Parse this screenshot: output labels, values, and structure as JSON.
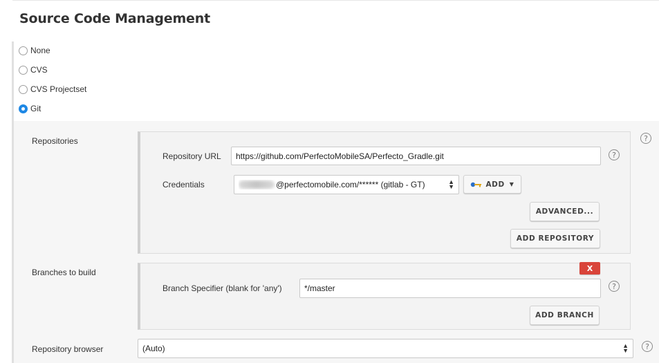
{
  "section": {
    "title": "Source Code Management"
  },
  "scm_options": [
    {
      "label": "None",
      "selected": false
    },
    {
      "label": "CVS",
      "selected": false
    },
    {
      "label": "CVS Projectset",
      "selected": false
    },
    {
      "label": "Git",
      "selected": true
    }
  ],
  "repositories": {
    "label": "Repositories",
    "url_label": "Repository URL",
    "url_value": "https://github.com/PerfectoMobileSA/Perfecto_Gradle.git",
    "credentials_label": "Credentials",
    "credentials_value": "@perfectomobile.com/****** (gitlab - GT)",
    "add_label": "ADD",
    "advanced_label": "ADVANCED...",
    "add_repository_label": "ADD REPOSITORY"
  },
  "branches": {
    "label": "Branches to build",
    "delete_label": "X",
    "specifier_label": "Branch Specifier (blank for 'any')",
    "specifier_value": "*/master",
    "add_branch_label": "ADD BRANCH"
  },
  "repository_browser": {
    "label": "Repository browser",
    "value": "(Auto)"
  },
  "help_glyph": "?",
  "colors": {
    "accent": "#1e88e5",
    "delete": "#d9443a",
    "panel": "#f3f3f3"
  }
}
